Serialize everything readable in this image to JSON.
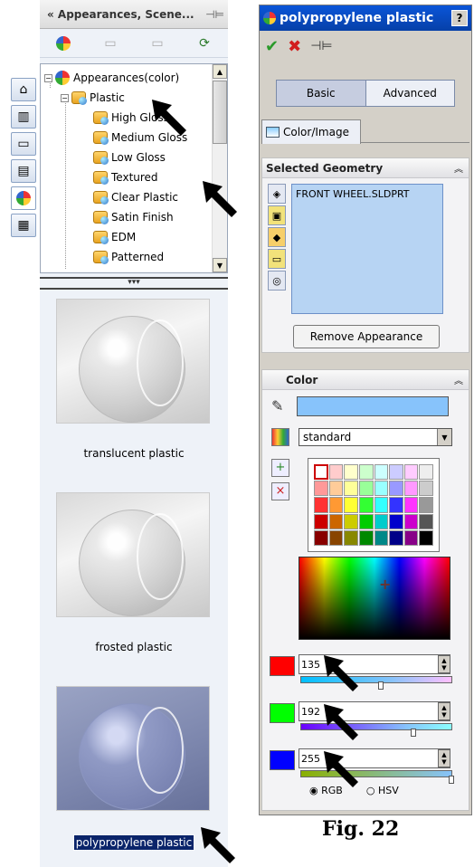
{
  "left_pane": {
    "title": "« Appearances, Scene...",
    "pin": "⊣⊨",
    "tree": {
      "root": "Appearances(color)",
      "folder": "Plastic",
      "items": [
        "High Gloss",
        "Medium Gloss",
        "Low Gloss",
        "Textured",
        "Clear Plastic",
        "Satin Finish",
        "EDM",
        "Patterned"
      ]
    },
    "previews": [
      {
        "caption": "translucent plastic",
        "selected": false
      },
      {
        "caption": "frosted plastic",
        "selected": false
      },
      {
        "caption": "polypropylene plastic",
        "selected": true
      }
    ]
  },
  "property_manager": {
    "title": "polypropylene plastic",
    "help": "?",
    "basic": "Basic",
    "advanced": "Advanced",
    "tab_color_image": "Color/Image",
    "selected_geometry": {
      "header": "Selected Geometry",
      "items": [
        "FRONT WHEEL.SLDPRT"
      ],
      "remove_button": "Remove Appearance"
    },
    "color": {
      "header": "Color",
      "swatch_color": "#87c3fb",
      "palette_mode": "standard",
      "red": "135",
      "green": "192",
      "blue": "255",
      "rgb_label": "RGB",
      "hsv_label": "HSV"
    }
  },
  "figure_caption": "Fig. 22"
}
